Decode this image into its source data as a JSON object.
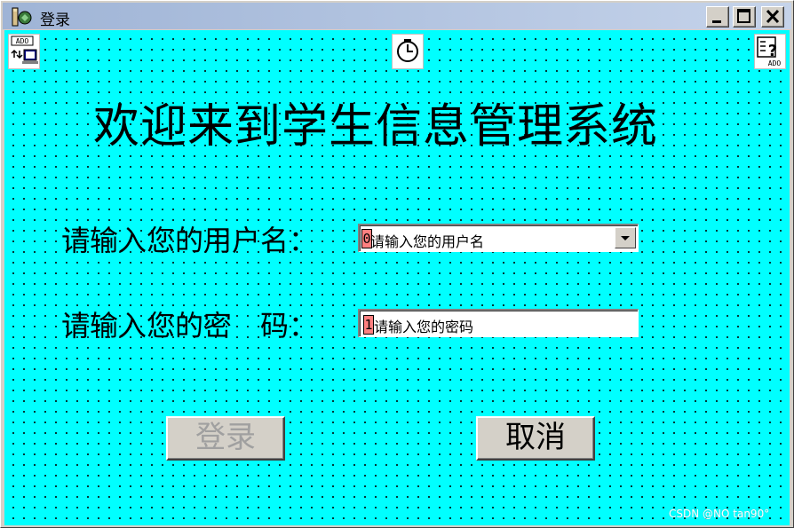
{
  "window": {
    "title": "登录",
    "icon": "vb-form-icon",
    "controls": [
      "minimize-icon",
      "maximize-icon",
      "close-icon"
    ]
  },
  "toolbar_icons": {
    "ado_left": "ado-data-control-icon",
    "timer": "timer-clock-icon",
    "ado_right": "ado-help-control-icon",
    "ado_label": "ADO"
  },
  "form": {
    "heading": "欢迎来到学生信息管理系统",
    "username_label": "请输入您的用户名：",
    "username_tab_index": "0",
    "username_text": "请输入您的用户名",
    "password_label": "请输入您的密　码：",
    "password_tab_index": "1",
    "password_text": "请输入您的密码",
    "login_button": "登录",
    "cancel_button": "取消"
  },
  "watermark": "CSDN @NO tan90°",
  "colors": {
    "client_background": "#00ffff",
    "grid_dots": "#000000",
    "tab_badge": "#ff8080",
    "disabled_text": "#a0a0a0"
  }
}
